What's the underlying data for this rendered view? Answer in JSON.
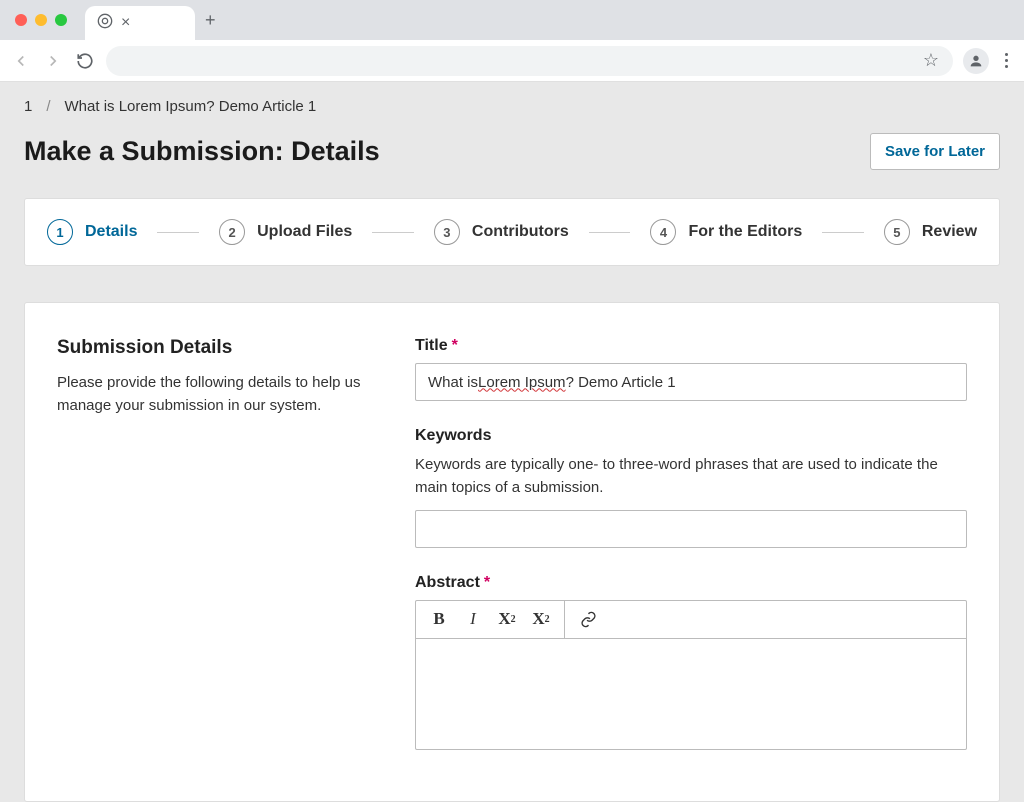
{
  "breadcrumb": {
    "step": "1",
    "title": "What is Lorem Ipsum? Demo Article 1"
  },
  "page_title": "Make a Submission: Details",
  "save_label": "Save for Later",
  "steps": [
    {
      "num": "1",
      "label": "Details"
    },
    {
      "num": "2",
      "label": "Upload Files"
    },
    {
      "num": "3",
      "label": "Contributors"
    },
    {
      "num": "4",
      "label": "For the Editors"
    },
    {
      "num": "5",
      "label": "Review"
    }
  ],
  "sidebar": {
    "title": "Submission Details",
    "desc": "Please provide the following details to help us manage your submission in our system."
  },
  "fields": {
    "title": {
      "label": "Title",
      "value_pre": "What is ",
      "value_spell": "Lorem Ipsum",
      "value_post": "? Demo Article 1"
    },
    "keywords": {
      "label": "Keywords",
      "help": "Keywords are typically one- to three-word phrases that are used to indicate the main topics of a submission.",
      "value": ""
    },
    "abstract": {
      "label": "Abstract"
    }
  }
}
